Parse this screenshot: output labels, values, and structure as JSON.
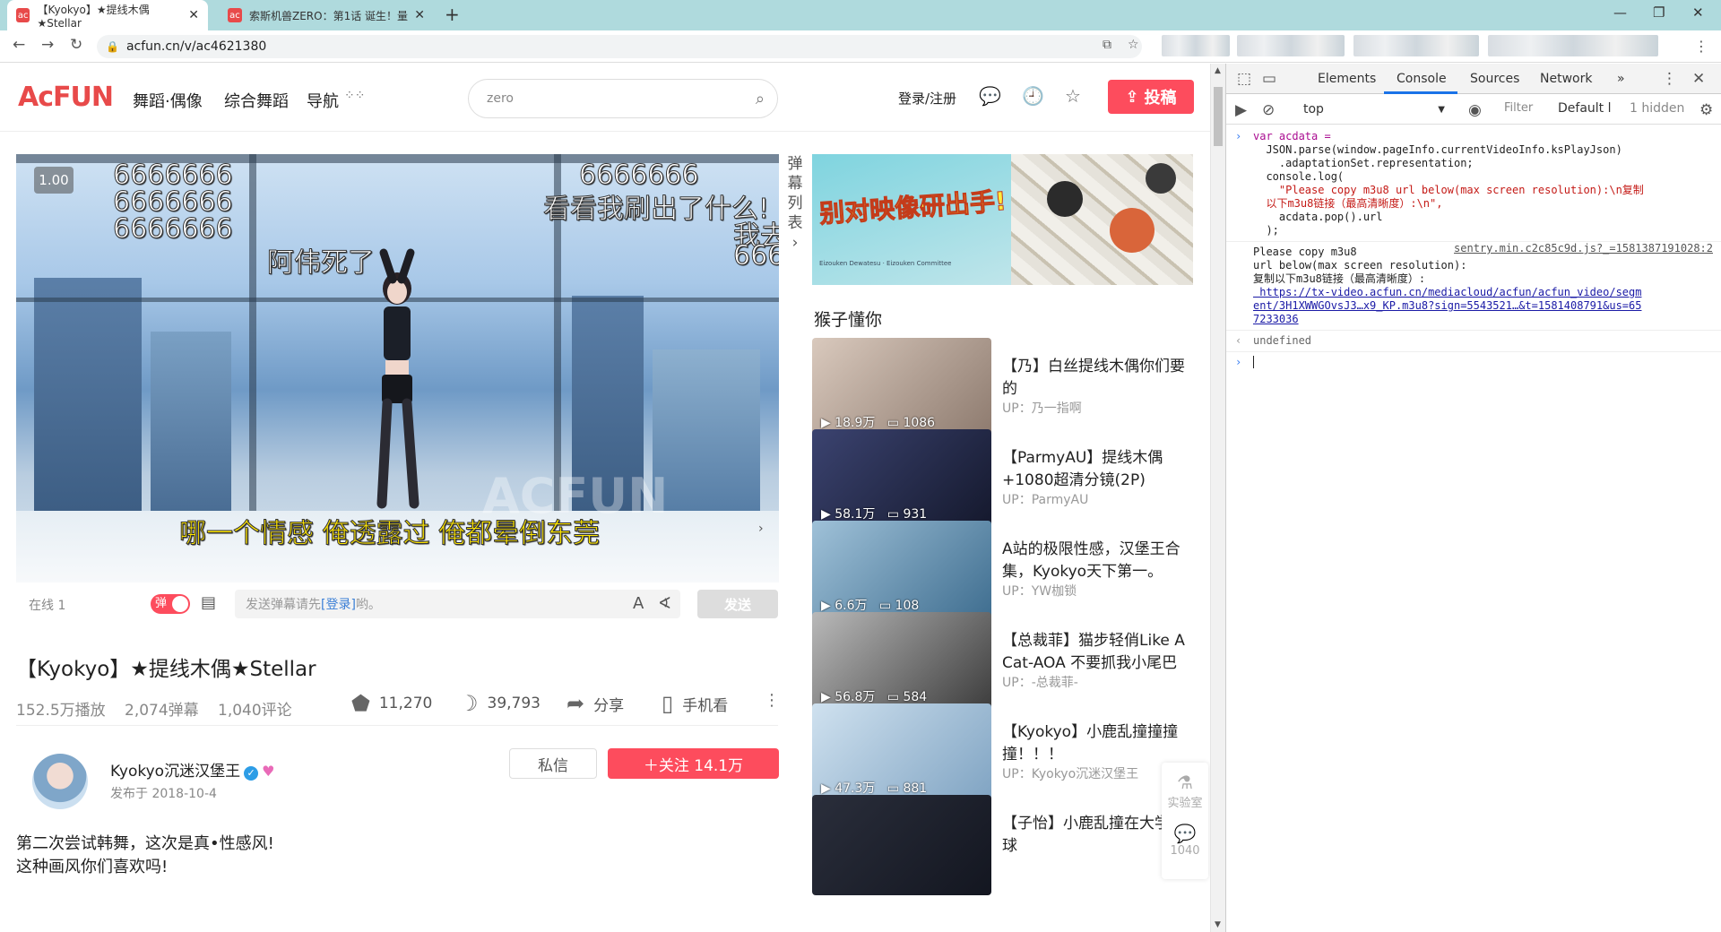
{
  "browser": {
    "tabs": [
      {
        "title": "【Kyokyo】★提线木偶★Stellar",
        "close": "✕"
      },
      {
        "title": "索斯机兽ZERO：第1话 诞生！量",
        "close": "✕"
      }
    ],
    "new_tab": "+",
    "window_controls": [
      "—",
      "❐",
      "✕"
    ],
    "url": "acfun.cn/v/ac4621380"
  },
  "header": {
    "logo": "AcFUN",
    "nav": [
      "舞蹈·偶像",
      "综合舞蹈",
      "导航"
    ],
    "search_placeholder": "zero",
    "login": "登录/注册",
    "submit_label": "投稿"
  },
  "player": {
    "speed": "1.00",
    "danmaku": [
      "6666666",
      "6666666",
      "6666666",
      "6666666",
      "看看我刷出了什么!",
      "我去",
      "666",
      "阿伟死了",
      "哪一个情感 俺透露过 俺都晕倒东莞"
    ],
    "watermark": "ACFUN",
    "danmaku_list_label": "弹幕列表",
    "online": "在线  1",
    "toggle": "弹",
    "input_placeholder_pre": "发送弹幕请先",
    "input_link": "[登录]",
    "input_placeholder_post": "哟。",
    "send": "发送"
  },
  "video": {
    "title": "【Kyokyo】★提线木偶★Stellar",
    "plays": "152.5万播放",
    "danmaku_count": "2,074弹幕",
    "comments": "1,040评论",
    "likes": "11,270",
    "bananas": "39,793",
    "share": "分享",
    "mobile": "手机看"
  },
  "uploader": {
    "name": "Kyokyo沉迷汉堡王",
    "published": "发布于   2018-10-4",
    "message": "私信",
    "follow": "＋关注  14.1万"
  },
  "description": [
    "第二次尝试韩舞，这次是真•性感风!",
    "这种画风你们喜欢吗!"
  ],
  "banner": {
    "text": "别对映像研出手!",
    "sub": "Eizouken Dewatesu · Eizouken Committee"
  },
  "related_title": "猴子懂你",
  "related": [
    {
      "title": "【乃】白丝提线木偶你们要的",
      "up": "UP：乃一指啊",
      "plays": "18.9万",
      "dm": "1086",
      "color1": "#d9c9bd",
      "color2": "#8d7a6e"
    },
    {
      "title": "【ParmyAU】提线木偶+1080超清分镜(2P)",
      "up": "UP：ParmyAU",
      "plays": "58.1万",
      "dm": "931",
      "color1": "#3b4370",
      "color2": "#14182c"
    },
    {
      "title": "A站的极限性感，汉堡王合集，Kyokyo天下第一。",
      "up": "UP：YW枷锁",
      "plays": "6.6万",
      "dm": "108",
      "color1": "#9fc1d8",
      "color2": "#3e6d8f"
    },
    {
      "title": "【总裁菲】猫步轻俏Like A Cat-AOA 不要抓我小尾巴",
      "up": "UP：-总裁菲-",
      "plays": "56.8万",
      "dm": "584",
      "color1": "#b9b9b9",
      "color2": "#3b3b3b"
    },
    {
      "title": "【Kyokyo】小鹿乱撞撞撞撞！！！",
      "up": "UP：Kyokyo沉迷汉堡王",
      "plays": "47.3万",
      "dm": "881",
      "color1": "#cfe1ef",
      "color2": "#7fa3c2"
    },
    {
      "title": "【子怡】小鹿乱撞在大学篮球",
      "up": "",
      "plays": "",
      "dm": "",
      "color1": "#2a2e3b",
      "color2": "#131620"
    }
  ],
  "float": {
    "lab": "实验室",
    "comments": "1040"
  },
  "devtools": {
    "tabs": [
      "Elements",
      "Console",
      "Sources",
      "Network"
    ],
    "context": "top",
    "filter": "Filter",
    "levels": "Default l",
    "hidden": "1 hidden",
    "code": [
      "var acdata =",
      "  JSON.parse(window.pageInfo.currentVideoInfo.ksPlayJson)",
      "    .adaptationSet.representation;",
      "  console.log(",
      "    \"Please copy m3u8 url below(max screen resolution):\\n复制",
      "  以下m3u8链接（最高清晰度）:\\n\",",
      "    acdata.pop().url",
      "  );"
    ],
    "output": [
      "Please copy m3u8",
      "url below(max screen resolution):",
      "复制以下m3u8链接（最高清晰度）:"
    ],
    "source": "sentry.min.c2c85c9d.js?_=1581387191028:2",
    "m3u8": [
      " https://tx-video.acfun.cn/mediacloud/acfun/acfun_video/segm",
      "ent/3H1XWWGOvsJ3…x9_KP.m3u8?sign=5543521…&t=1581408791&us=65",
      "7233036"
    ],
    "result": "undefined"
  }
}
